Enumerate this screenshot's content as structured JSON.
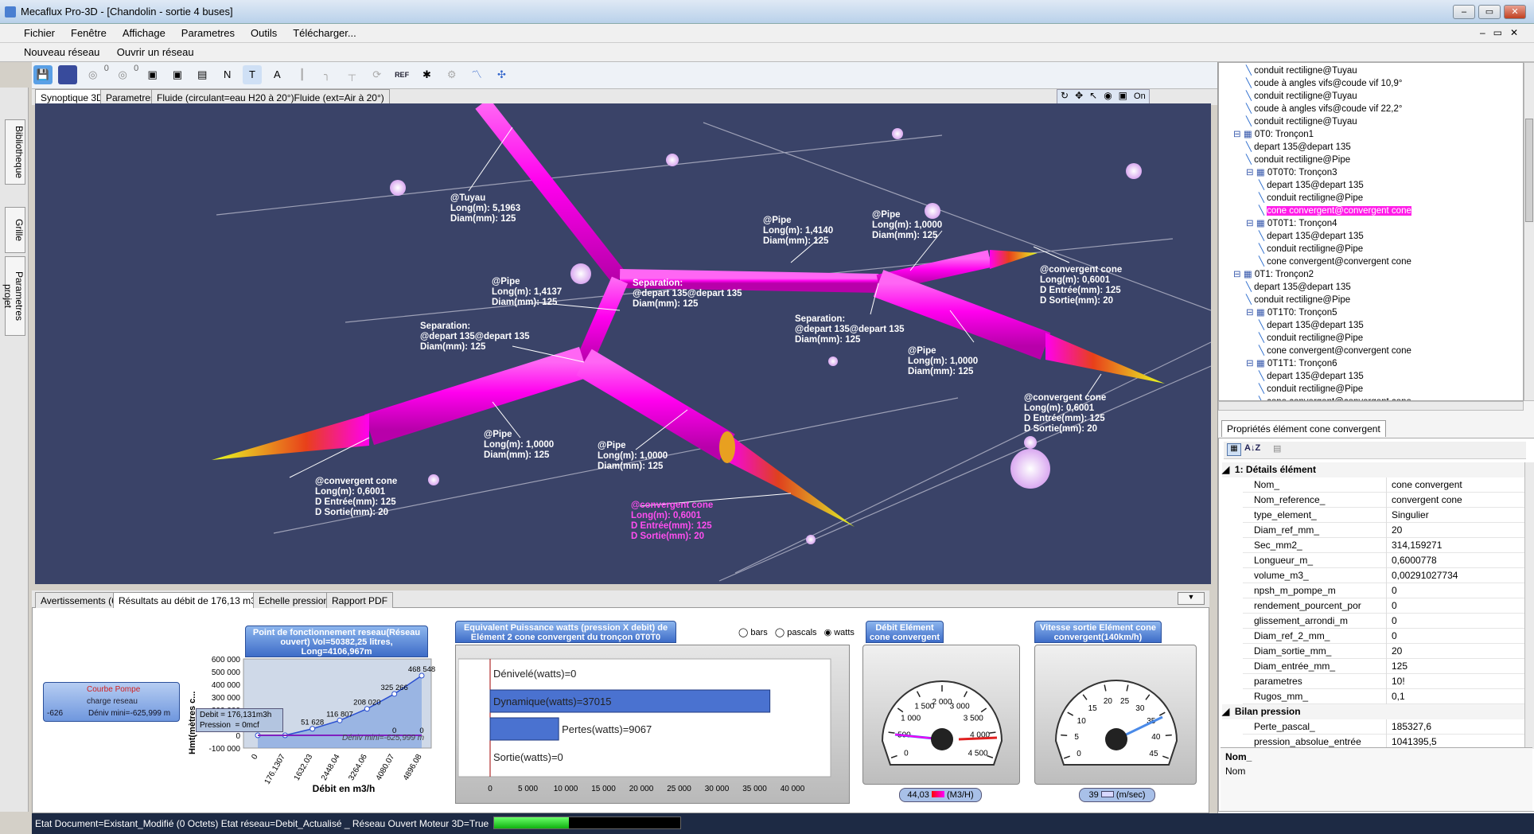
{
  "window": {
    "title": "Mecaflux Pro-3D - [Chandolin - sortie 4 buses]",
    "controls": [
      "–",
      "▭",
      "✕"
    ]
  },
  "menu": [
    "Fichier",
    "Fenêtre",
    "Affichage",
    "Parametres",
    "Outils",
    "Télécharger..."
  ],
  "netbar": {
    "new": "Nouveau réseau",
    "open": "Ouvrir un réseau"
  },
  "side_tabs": [
    "Bibliotheque",
    "Grille",
    "Parametres projet"
  ],
  "toolbar": {
    "count1": "0",
    "count2": "0",
    "on_label": "On"
  },
  "view_tabs": [
    "Synoptique 3D",
    "Parametres",
    "Fluide (circulant=eau H20 à 20°)Fluide (ext=Air à 20°)"
  ],
  "labels3d": [
    "@Tuyau\nLong(m): 5,1963\nDiam(mm): 125",
    "@Pipe\nLong(m): 1,4140\nDiam(mm): 125",
    "@Pipe\nLong(m): 1,0000\nDiam(mm): 125",
    "@convergent cone\nLong(m): 0,6001\nD Entrée(mm): 125\nD Sortie(mm): 20",
    "@Pipe\nLong(m): 1,4137\nDiam(mm): 125",
    "Separation:\n@depart 135@depart 135\nDiam(mm): 125",
    "Separation:\n@depart 135@depart 135\nDiam(mm): 125",
    "Separation:\n@depart 135@depart 135\nDiam(mm): 125",
    "@Pipe\nLong(m): 1,0000\nDiam(mm): 125",
    "@convergent cone\nLong(m): 0,6001\nD Entrée(mm): 125\nD Sortie(mm): 20",
    "@Pipe\nLong(m): 1,0000\nDiam(mm): 125",
    "@Pipe\nLong(m): 1,0000\nDiam(mm): 125",
    "@convergent cone\nLong(m): 0,6001\nD Entrée(mm): 125\nD Sortie(mm): 20",
    "@convergent cone\nLong(m): 0,6001\nD Entrée(mm): 125\nD Sortie(mm): 20"
  ],
  "bottom_tabs": [
    "Avertissements (6)",
    "Résultats au débit de 176,13 m3/h",
    "Echelle pressions",
    "Rapport PDF"
  ],
  "chart1": {
    "header": "Point de fonctionnement reseau(Réseau ouvert) Vol=50382,25 litres, Long=4106,967m",
    "legend": [
      "Courbe Pompe",
      "charge reseau",
      "Déniv mini=-625,999 m"
    ],
    "legend_value": "-626",
    "ylabel": "Hmt(mètres c...",
    "xlabel": "Débit en m3/h",
    "tooltip": "Debit = 176,131m3h\nPression  = 0mcf",
    "deniv": "Déniv mini=-625,999 m"
  },
  "chart_data": [
    {
      "type": "line",
      "title": "Point de fonctionnement reseau(Réseau ouvert) Vol=50382,25 litres, Long=4106,967m",
      "xlabel": "Débit en m3/h",
      "ylabel": "Hmt(mètres c...",
      "x": [
        "0",
        "176.1307",
        "1632.03",
        "2448.04",
        "3264.06",
        "4080.07",
        "4896.08"
      ],
      "ylim": [
        -100000,
        600000
      ],
      "yticks": [
        "600 000",
        "500 000",
        "400 000",
        "300 000",
        "200 000",
        "100 000",
        "0",
        "-100 000"
      ],
      "series": [
        {
          "name": "charge reseau",
          "values": [
            0,
            0,
            51628,
            116807,
            208020,
            325266,
            468548
          ]
        },
        {
          "name": "Courbe Pompe",
          "values": [
            0,
            0,
            0,
            0,
            0,
            0,
            0
          ]
        }
      ],
      "data_labels": [
        "468 548",
        "325 266",
        "208 020",
        "116 807",
        "51 628",
        "0",
        "0",
        "0"
      ]
    },
    {
      "type": "bar",
      "title": "Equivalent Puissance watts (pression X debit) de Elément 2 cone convergent du tronçon 0T0T0",
      "categories": [
        "Dénivelé(watts)=0",
        "Dynamique(watts)=37015",
        "Pertes(watts)=9067",
        "Sortie(watts)=0"
      ],
      "values": [
        0,
        37015,
        9067,
        0
      ],
      "xlim": [
        0,
        40000
      ],
      "xticks": [
        "0",
        "5 000",
        "10 000",
        "15 000",
        "20 000",
        "25 000",
        "30 000",
        "35 000",
        "40 000"
      ]
    },
    {
      "type": "gauge",
      "title": "Débit Elément cone convergent",
      "value": 44.03,
      "unit": "(M3/H)",
      "ticks": [
        "0",
        "500",
        "1 000",
        "1 500",
        "2 000",
        "3 000",
        "3 500",
        "4 000",
        "4 500"
      ]
    },
    {
      "type": "gauge",
      "title": "Vitesse sortie Elément cone convergent(140km/h)",
      "value": 39,
      "unit": "(m/sec)",
      "ticks": [
        "0",
        "5",
        "10",
        "15",
        "20",
        "25",
        "30",
        "35",
        "40",
        "45"
      ]
    }
  ],
  "radio": {
    "options": [
      "bars",
      "pascals",
      "watts"
    ],
    "selected": "watts"
  },
  "gauge1": {
    "readout": "44,03",
    "unit": "(M3/H)"
  },
  "gauge2": {
    "readout": "39",
    "unit": "(m/sec)"
  },
  "tree": [
    {
      "label": "conduit rectiligne@Tuyau",
      "d": 3
    },
    {
      "label": "coude à angles vifs@coude vif 10,9°",
      "d": 3
    },
    {
      "label": "conduit rectiligne@Tuyau",
      "d": 3
    },
    {
      "label": "coude à angles vifs@coude vif 22,2°",
      "d": 3
    },
    {
      "label": "conduit rectiligne@Tuyau",
      "d": 3
    },
    {
      "label": "0T0: Tronçon1",
      "d": 2
    },
    {
      "label": "depart 135@depart 135",
      "d": 3
    },
    {
      "label": "conduit rectiligne@Pipe",
      "d": 3
    },
    {
      "label": "0T0T0: Tronçon3",
      "d": 3
    },
    {
      "label": "depart 135@depart 135",
      "d": 4
    },
    {
      "label": "conduit rectiligne@Pipe",
      "d": 4
    },
    {
      "label": "cone convergent@convergent cone",
      "d": 4,
      "sel": true
    },
    {
      "label": "0T0T1: Tronçon4",
      "d": 3
    },
    {
      "label": "depart 135@depart 135",
      "d": 4
    },
    {
      "label": "conduit rectiligne@Pipe",
      "d": 4
    },
    {
      "label": "cone convergent@convergent cone",
      "d": 4
    },
    {
      "label": "0T1: Tronçon2",
      "d": 2
    },
    {
      "label": "depart 135@depart 135",
      "d": 3
    },
    {
      "label": "conduit rectiligne@Pipe",
      "d": 3
    },
    {
      "label": "0T1T0: Tronçon5",
      "d": 3
    },
    {
      "label": "depart 135@depart 135",
      "d": 4
    },
    {
      "label": "conduit rectiligne@Pipe",
      "d": 4
    },
    {
      "label": "cone convergent@convergent cone",
      "d": 4
    },
    {
      "label": "0T1T1: Tronçon6",
      "d": 3
    },
    {
      "label": "depart 135@depart 135",
      "d": 4
    },
    {
      "label": "conduit rectiligne@Pipe",
      "d": 4
    },
    {
      "label": "cone convergent@convergent cone",
      "d": 4
    }
  ],
  "props": {
    "tab": "Propriétés élément cone convergent",
    "section1": "1: Détails élément",
    "rows1": [
      [
        "Nom_",
        "cone convergent"
      ],
      [
        "Nom_reference_",
        "convergent cone"
      ],
      [
        "type_element_",
        "Singulier"
      ],
      [
        "Diam_ref_mm_",
        "20"
      ],
      [
        "Sec_mm2_",
        "314,159271"
      ],
      [
        "Longueur_m_",
        "0,6000778"
      ],
      [
        "volume_m3_",
        "0,00291027734"
      ],
      [
        "npsh_m_pompe_m",
        "0"
      ],
      [
        "rendement_pourcent_por",
        "0"
      ],
      [
        "glissement_arrondi_m",
        "0"
      ],
      [
        "Diam_ref_2_mm_",
        "0"
      ],
      [
        "Diam_sortie_mm_",
        "20"
      ],
      [
        "Diam_entrée_mm_",
        "125"
      ],
      [
        "parametres",
        "10!"
      ],
      [
        "Rugos_mm_",
        "0,1"
      ]
    ],
    "section2": "Bilan pression",
    "rows2": [
      [
        "Perte_pascal_",
        "185327,6"
      ],
      [
        "pression_absolue_entrée",
        "1041395,5"
      ]
    ],
    "desc_title": "Nom_",
    "desc_text": "Nom"
  },
  "status": "Etat Document=Existant_Modifié (0 Octets)  Etat réseau=Debit_Actualisé  _ Réseau Ouvert  Moteur 3D=True",
  "colors": {
    "pipe": "#ff00ee",
    "viewport": "#3a4368",
    "cone_hot": "#e8401a",
    "cone_tip": "#e8ff20",
    "selection": "#ff1ee8"
  }
}
